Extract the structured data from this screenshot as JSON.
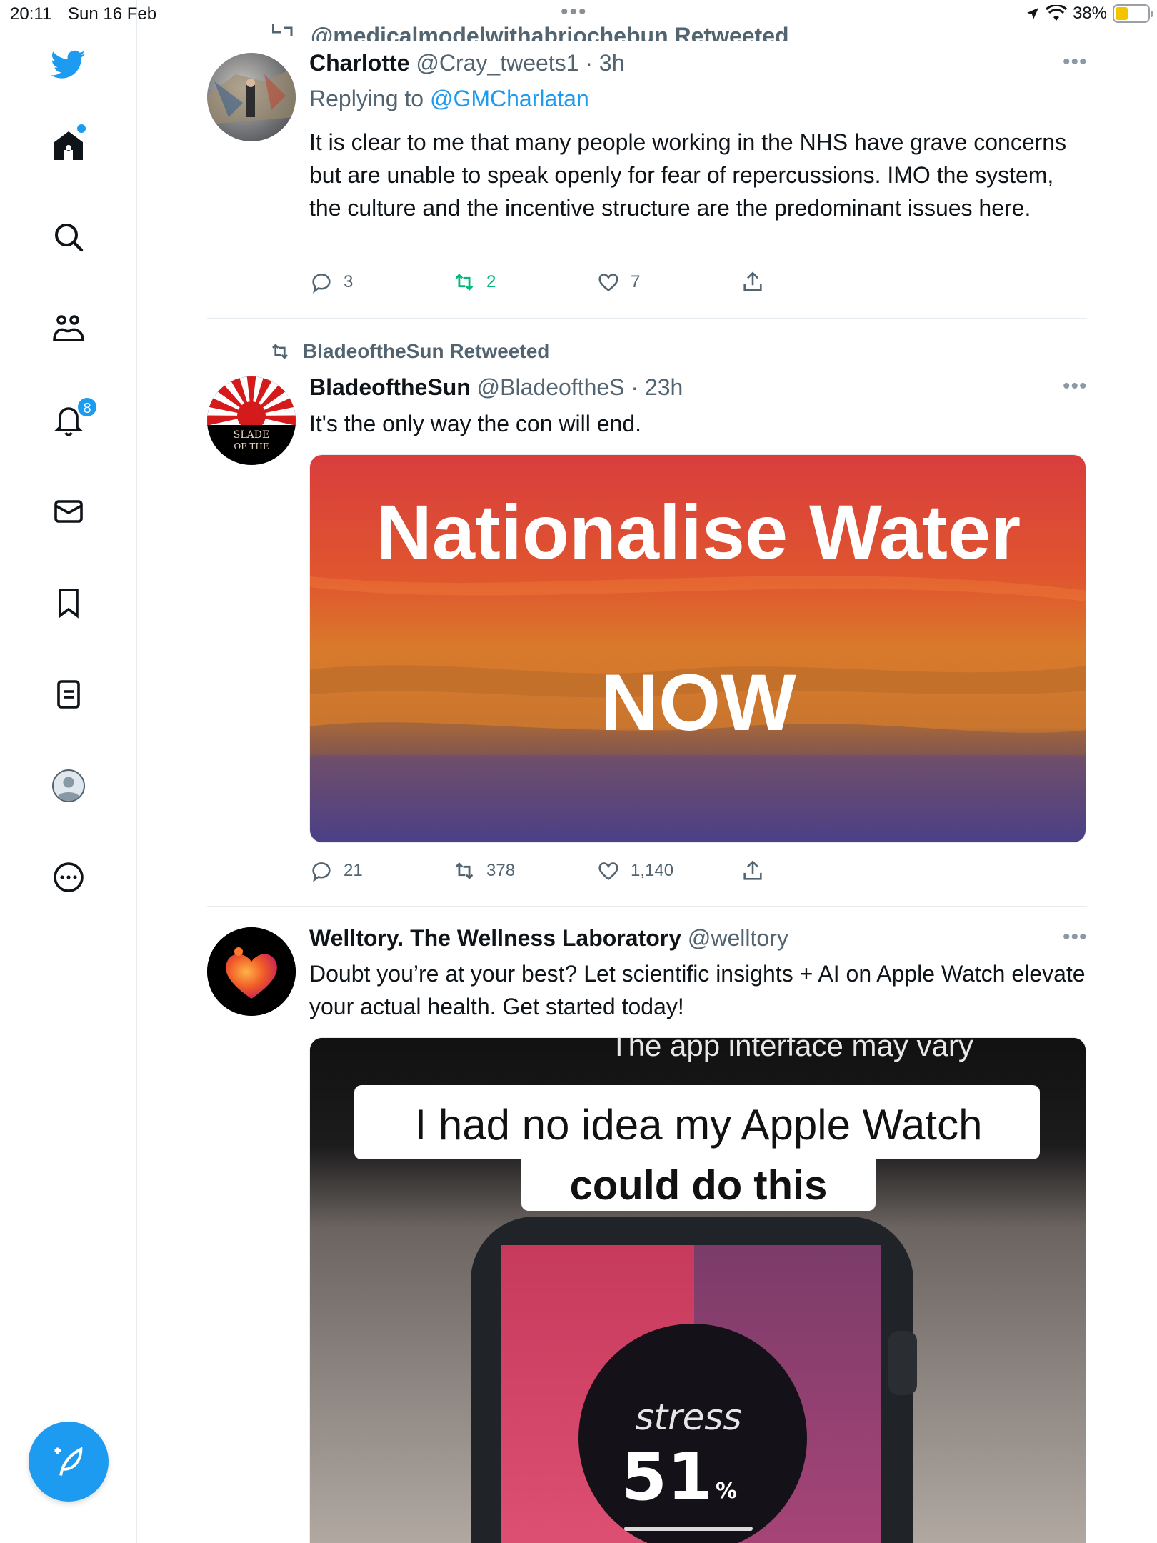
{
  "status_bar": {
    "time": "20:11",
    "date": "Sun 16 Feb",
    "battery": "38%",
    "battery_level": 0.38
  },
  "sidebar": {
    "notifications_count": "8",
    "icons": [
      "twitter-logo-icon",
      "home-icon",
      "search-icon",
      "communities-icon",
      "notifications-icon",
      "messages-icon",
      "bookmarks-icon",
      "lists-icon",
      "profile-icon",
      "more-icon"
    ],
    "brand_color": "#1d9bf0"
  },
  "feed": {
    "top_cutoff_text": "@medicalmodelwithabriochebun Retweeted",
    "tweets": [
      {
        "display_name": "Charlotte",
        "handle": "@Cray_tweets1",
        "time": "· 3h",
        "replying_label": "Replying to ",
        "replying_handle": "@GMCharlatan",
        "text": "It is clear to me that many people working in the NHS have grave concerns but are unable to speak openly for fear of repercussions. IMO the system, the culture and the incentive structure are the predominant issues here.",
        "replies": "3",
        "retweets": "2",
        "likes": "7"
      },
      {
        "retweet_context": "BladeoftheSun Retweeted",
        "display_name": "BladeoftheSun",
        "handle": "@BladeoftheS",
        "time": "· 23h",
        "text": "It's the only way the con will end.",
        "image_line1": "Nationalise Water",
        "image_line2": "NOW",
        "avatar_text1": "SLADE",
        "avatar_text2": "OF THE",
        "replies": "21",
        "retweets": "378",
        "likes": "1,140"
      },
      {
        "display_name": "Welltory. The Wellness Laboratory",
        "handle": "@welltory",
        "text": "Doubt you’re at your best? Let scientific insights + AI on Apple Watch elevate your actual health. Get started today!",
        "video_caption_top": "The app interface may vary",
        "video_title_line1": "I had no idea my Apple Watch",
        "video_title_line2": "could do this",
        "watch_label": "stress",
        "watch_value": "51",
        "watch_unit": "%"
      }
    ]
  }
}
